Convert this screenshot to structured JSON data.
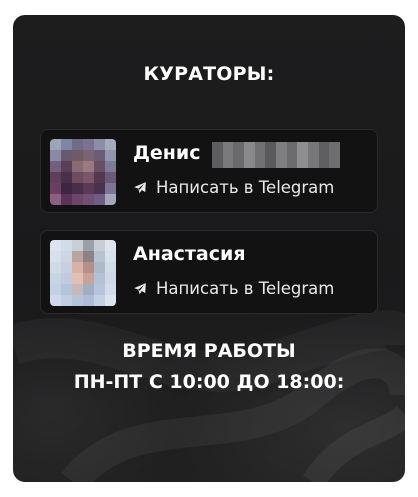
{
  "curators_section": {
    "title": "КУРАТОРЫ:",
    "curators": [
      {
        "name": "Денис",
        "surname_obscured": true,
        "avatar_icon": "person-photo-pixelated",
        "link_icon": "telegram-send-icon",
        "link_label": "Написать в Telegram"
      },
      {
        "name": "Анастасия",
        "avatar_icon": "person-photo-pixelated",
        "link_icon": "telegram-send-icon",
        "link_label": "Написать в Telegram"
      }
    ]
  },
  "work_hours": {
    "line1": "ВРЕМЯ РАБОТЫ",
    "line2": "ПН-ПТ С 10:00 ДО 18:00:"
  },
  "colors": {
    "panel_bg": "#1c1c1d",
    "card_bg": "#121213",
    "text": "#ffffff"
  }
}
